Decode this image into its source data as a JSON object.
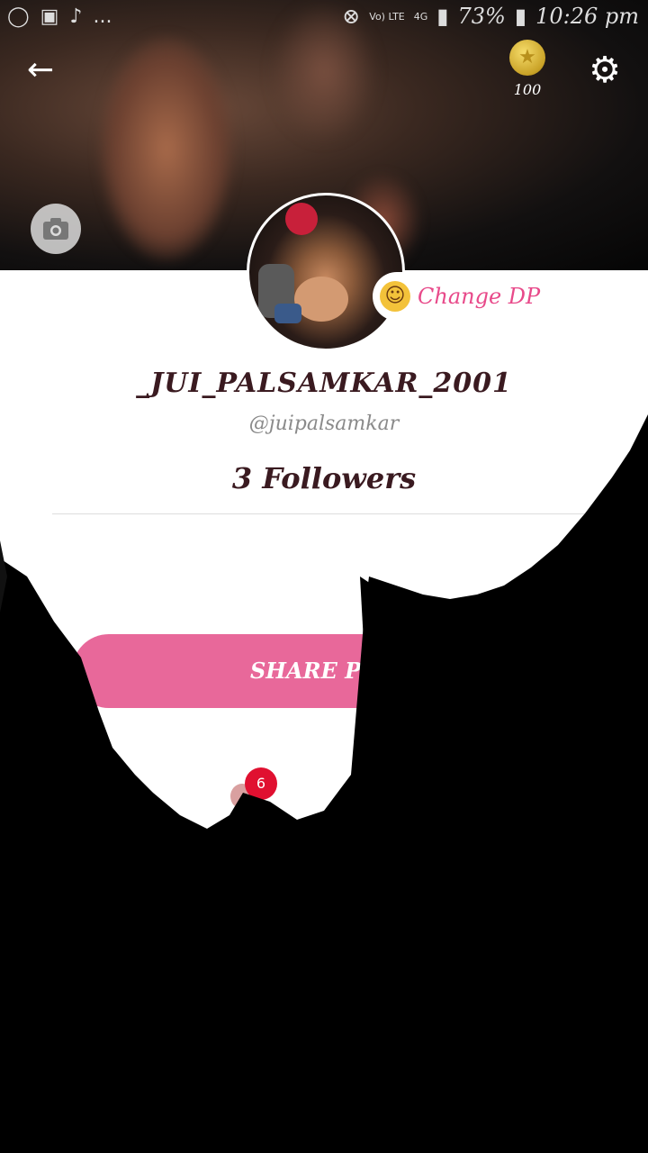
{
  "status_bar": {
    "left_icons": [
      "record-icon",
      "instagram-icon",
      "tiktok-icon"
    ],
    "more": "...",
    "volte": "Vo) LTE",
    "network": "4G",
    "battery": "73%",
    "time": "10:26 pm"
  },
  "header": {
    "back_icon": "arrow-left-icon",
    "coins": "100",
    "settings_icon": "gear-icon"
  },
  "profile": {
    "change_dp_label": "Change DP",
    "username": "_JUI_PALSAMKAR_2001",
    "handle": "@juipalsamkar",
    "followers": "3 Followers",
    "share_label": "SHARE PRO",
    "notification_count": "6"
  },
  "colors": {
    "accent_pink": "#e8689a",
    "badge_red": "#e01030"
  }
}
